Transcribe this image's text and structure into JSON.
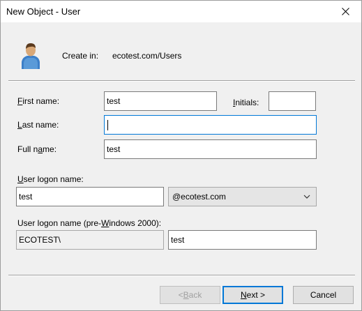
{
  "window": {
    "title": "New Object - User",
    "close_icon": "close-icon"
  },
  "header": {
    "icon": "user-icon",
    "create_in_label": "Create in:",
    "create_in_value": "ecotest.com/Users"
  },
  "form": {
    "first_name": {
      "label_pre": "",
      "label_key": "F",
      "label_post": "irst name:",
      "value": "test"
    },
    "initials": {
      "label_pre": "",
      "label_key": "I",
      "label_post": "nitials:",
      "value": ""
    },
    "last_name": {
      "label_pre": "",
      "label_key": "L",
      "label_post": "ast name:",
      "value": ""
    },
    "full_name": {
      "label_pre": "Full n",
      "label_key": "a",
      "label_post": "me:",
      "value": "test"
    },
    "logon_name": {
      "label_pre": "",
      "label_key": "U",
      "label_post": "ser logon name:",
      "value": "test"
    },
    "upn_suffix": {
      "selected": "@ecotest.com"
    },
    "pre2000": {
      "label_pre": "User logon name (pre-",
      "label_key": "W",
      "label_post": "indows 2000):",
      "domain": "ECOTEST\\",
      "value": "test"
    }
  },
  "buttons": {
    "back": {
      "pre": "< ",
      "key": "B",
      "post": "ack"
    },
    "next": {
      "pre": "",
      "key": "N",
      "post": "ext >"
    },
    "cancel": "Cancel"
  },
  "colors": {
    "focus": "#0078d7",
    "dialog_bg": "#f0f0f0"
  }
}
